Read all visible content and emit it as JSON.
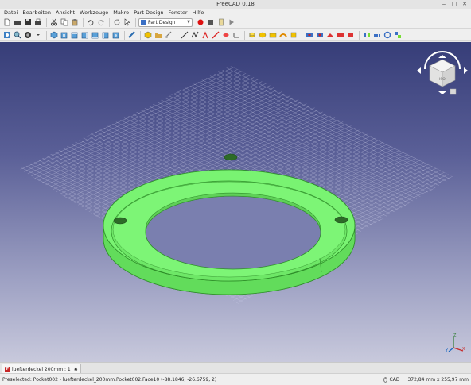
{
  "window": {
    "title": "FreeCAD 0.18"
  },
  "menu": [
    "Datei",
    "Bearbeiten",
    "Ansicht",
    "Werkzeuge",
    "Makro",
    "Part Design",
    "Fenster",
    "Hilfe"
  ],
  "toolbar": {
    "workbench": "Part Design"
  },
  "viewport": {
    "background_top": "#363d78",
    "background_bottom": "#c8c9dc",
    "model_color": "#74f06d",
    "model_edge_color": "#2f8e2a"
  },
  "navcube": {
    "face_label": "ISO"
  },
  "axis": {
    "x": "X",
    "y": "Y",
    "z": "Z"
  },
  "document_tab": {
    "label": "luefterdeckel 200mm : 1"
  },
  "status": {
    "message": "Preselected: Pocket002 - luefterdeckel_200mm.Pocket002.Face10 (-88.1846, -26.6759, 2)",
    "nav_style": "CAD",
    "dimensions": "372,84 mm x 255,97 mm"
  }
}
